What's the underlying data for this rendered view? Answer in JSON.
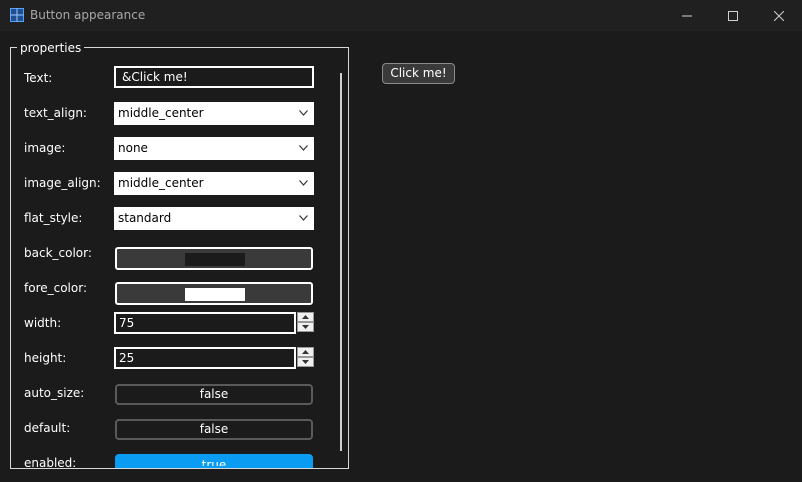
{
  "window": {
    "title": "Button appearance",
    "icon": "app-grid-icon"
  },
  "properties": {
    "group_title": "properties",
    "text": {
      "label": "Text:",
      "value": "&Click me!"
    },
    "text_align": {
      "label": "text_align:",
      "value": "middle_center"
    },
    "image": {
      "label": "image:",
      "value": "none"
    },
    "image_align": {
      "label": "image_align:",
      "value": "middle_center"
    },
    "flat_style": {
      "label": "flat_style:",
      "value": "standard"
    },
    "back_color": {
      "label": "back_color:",
      "swatch": "#1b1b1b"
    },
    "fore_color": {
      "label": "fore_color:",
      "swatch": "#ffffff"
    },
    "width": {
      "label": "width:",
      "value": "75"
    },
    "height": {
      "label": "height:",
      "value": "25"
    },
    "auto_size": {
      "label": "auto_size:",
      "value": "false"
    },
    "default": {
      "label": "default:",
      "value": "false"
    },
    "enabled": {
      "label": "enabled:",
      "value": "true"
    }
  },
  "preview": {
    "label": "Click me!"
  },
  "colors": {
    "accent": "#0a9cf2",
    "background": "#1b1b1b",
    "titlebar": "#202020"
  }
}
